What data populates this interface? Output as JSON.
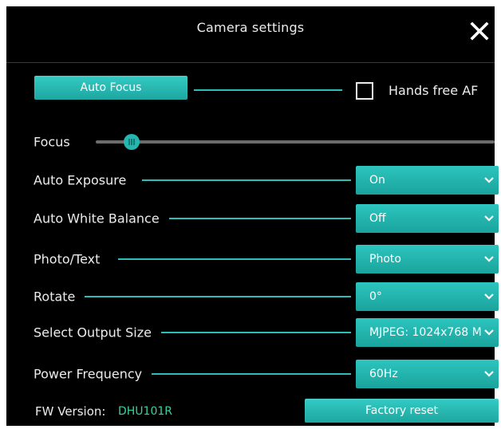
{
  "window": {
    "title": "Camera settings",
    "close_icon": "close-icon"
  },
  "auto_focus": {
    "button_label": "Auto Focus",
    "hands_free_label": "Hands free AF",
    "hands_free_checked": false
  },
  "focus": {
    "label": "Focus",
    "level": 0.09
  },
  "settings": [
    {
      "label": "Auto Exposure",
      "value": "On"
    },
    {
      "label": "Auto White Balance",
      "value": "Off"
    },
    {
      "label": "Photo/Text",
      "value": "Photo"
    },
    {
      "label": "Rotate",
      "value": "0°"
    },
    {
      "label": "Select Output Size",
      "value": "MJPEG: 1024x768 M"
    },
    {
      "label": "Power Frequency",
      "value": "60Hz"
    }
  ],
  "footer": {
    "fw_label": "FW Version:",
    "fw_value": "DHU101R",
    "reset_label": "Factory reset"
  },
  "colors": {
    "background": "#000000",
    "accent": "#2bbfb8",
    "text": "#ececec",
    "fw_version": "#39d39a"
  }
}
